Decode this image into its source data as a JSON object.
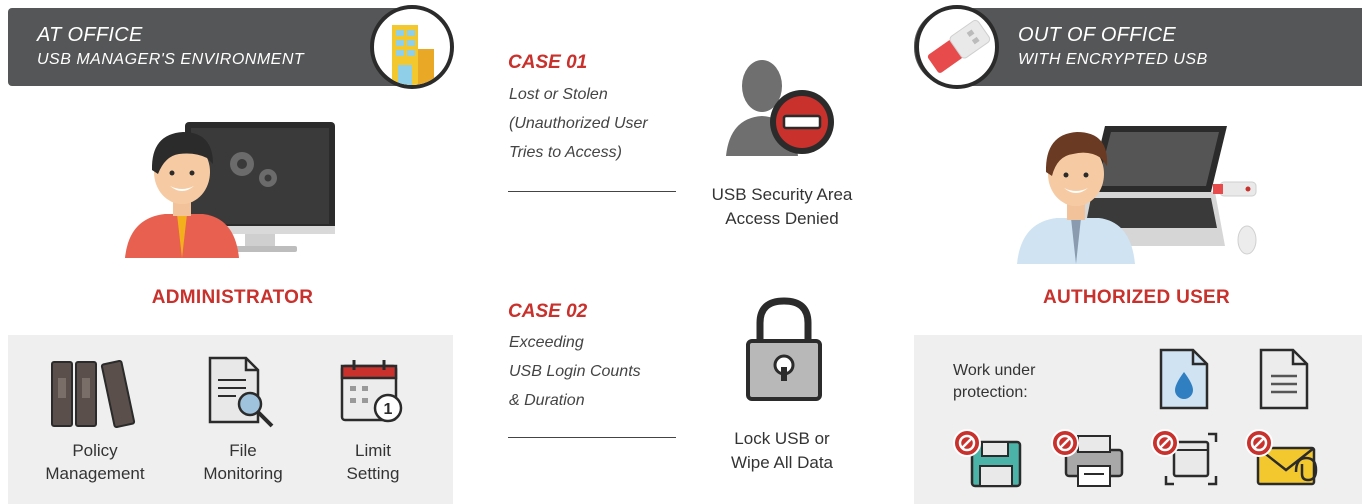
{
  "left": {
    "banner": {
      "title": "AT OFFICE",
      "subtitle": "USB MANAGER'S ENVIRONMENT",
      "icon": "office-building-icon"
    },
    "role": "ADMINISTRATOR",
    "tools": [
      {
        "line1": "Policy",
        "line2": "Management",
        "icon": "binders-icon"
      },
      {
        "line1": "File",
        "line2": "Monitoring",
        "icon": "file-search-icon"
      },
      {
        "line1": "Limit",
        "line2": "Setting",
        "icon": "calendar-limit-icon"
      }
    ]
  },
  "right": {
    "banner": {
      "title": "OUT OF OFFICE",
      "subtitle": "WITH ENCRYPTED USB",
      "icon": "usb-drive-icon"
    },
    "role": "AUTHORIZED USER",
    "work": {
      "line1": "Work under",
      "line2": "protection:"
    },
    "allowed_icons": [
      "water-document-icon",
      "text-document-icon"
    ],
    "blocked_icons": [
      "save-disk-blocked-icon",
      "printer-blocked-icon",
      "screen-capture-blocked-icon",
      "email-blocked-icon"
    ]
  },
  "cases": [
    {
      "title": "CASE 01",
      "desc": [
        "Lost or Stolen",
        "(Unauthorized User",
        "Tries to Access)"
      ],
      "result": [
        "USB Security Area",
        "Access Denied"
      ],
      "icon": "access-denied-user-icon"
    },
    {
      "title": "CASE 02",
      "desc": [
        "Exceeding",
        "USB Login Counts",
        "& Duration"
      ],
      "result": [
        "Lock USB or",
        "Wipe All Data"
      ],
      "icon": "padlock-icon"
    }
  ],
  "colors": {
    "accent_red": "#c8312c",
    "banner_gray": "#555657",
    "panel_gray": "#efefef"
  }
}
